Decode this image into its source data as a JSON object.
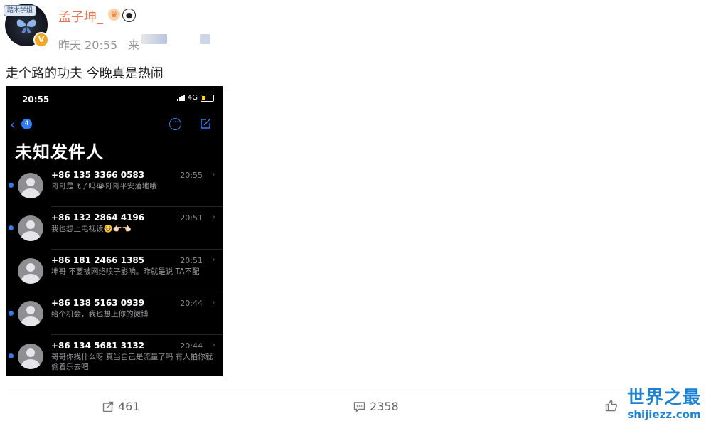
{
  "post": {
    "avatar_badge": "踏木学姐",
    "username": "孟子坤_",
    "time": "昨天 20:55",
    "source_prefix": "来",
    "text": "走个路的功夫 今晚真是热闹"
  },
  "phone": {
    "status_time": "20:55",
    "network": "4G",
    "back_count": "4",
    "title": "未知发件人",
    "messages": [
      {
        "number": "+86 135 3366 0583",
        "time": "20:55",
        "preview": "哥哥是飞了吗😭哥哥平安落地哦",
        "unread": true
      },
      {
        "number": "+86 132 2864 4196",
        "time": "20:51",
        "preview": "我也想上电视读🥺👉🏻👈🏻",
        "unread": true
      },
      {
        "number": "+86 181 2466 1385",
        "time": "20:51",
        "preview": "坤哥 不要被网络喷子影响。昨就是说 TA不配",
        "unread": false
      },
      {
        "number": "+86 138 5163 0939",
        "time": "20:44",
        "preview": "给个机会，我也想上你的微博",
        "unread": true
      },
      {
        "number": "+86 134 5681 3132",
        "time": "20:44",
        "preview": "哥哥你找什么呀 真当自己是流量了吗 有人拍你就偷着乐去吧",
        "unread": true
      }
    ]
  },
  "actions": {
    "repost_count": "461",
    "comment_count": "2358"
  },
  "watermark": {
    "cn": "世界之最",
    "en": "shijiezz.com"
  },
  "colors": {
    "username": "#eb7350",
    "ios_blue": "#2f7cf6",
    "watermark": "#1a83d9"
  }
}
